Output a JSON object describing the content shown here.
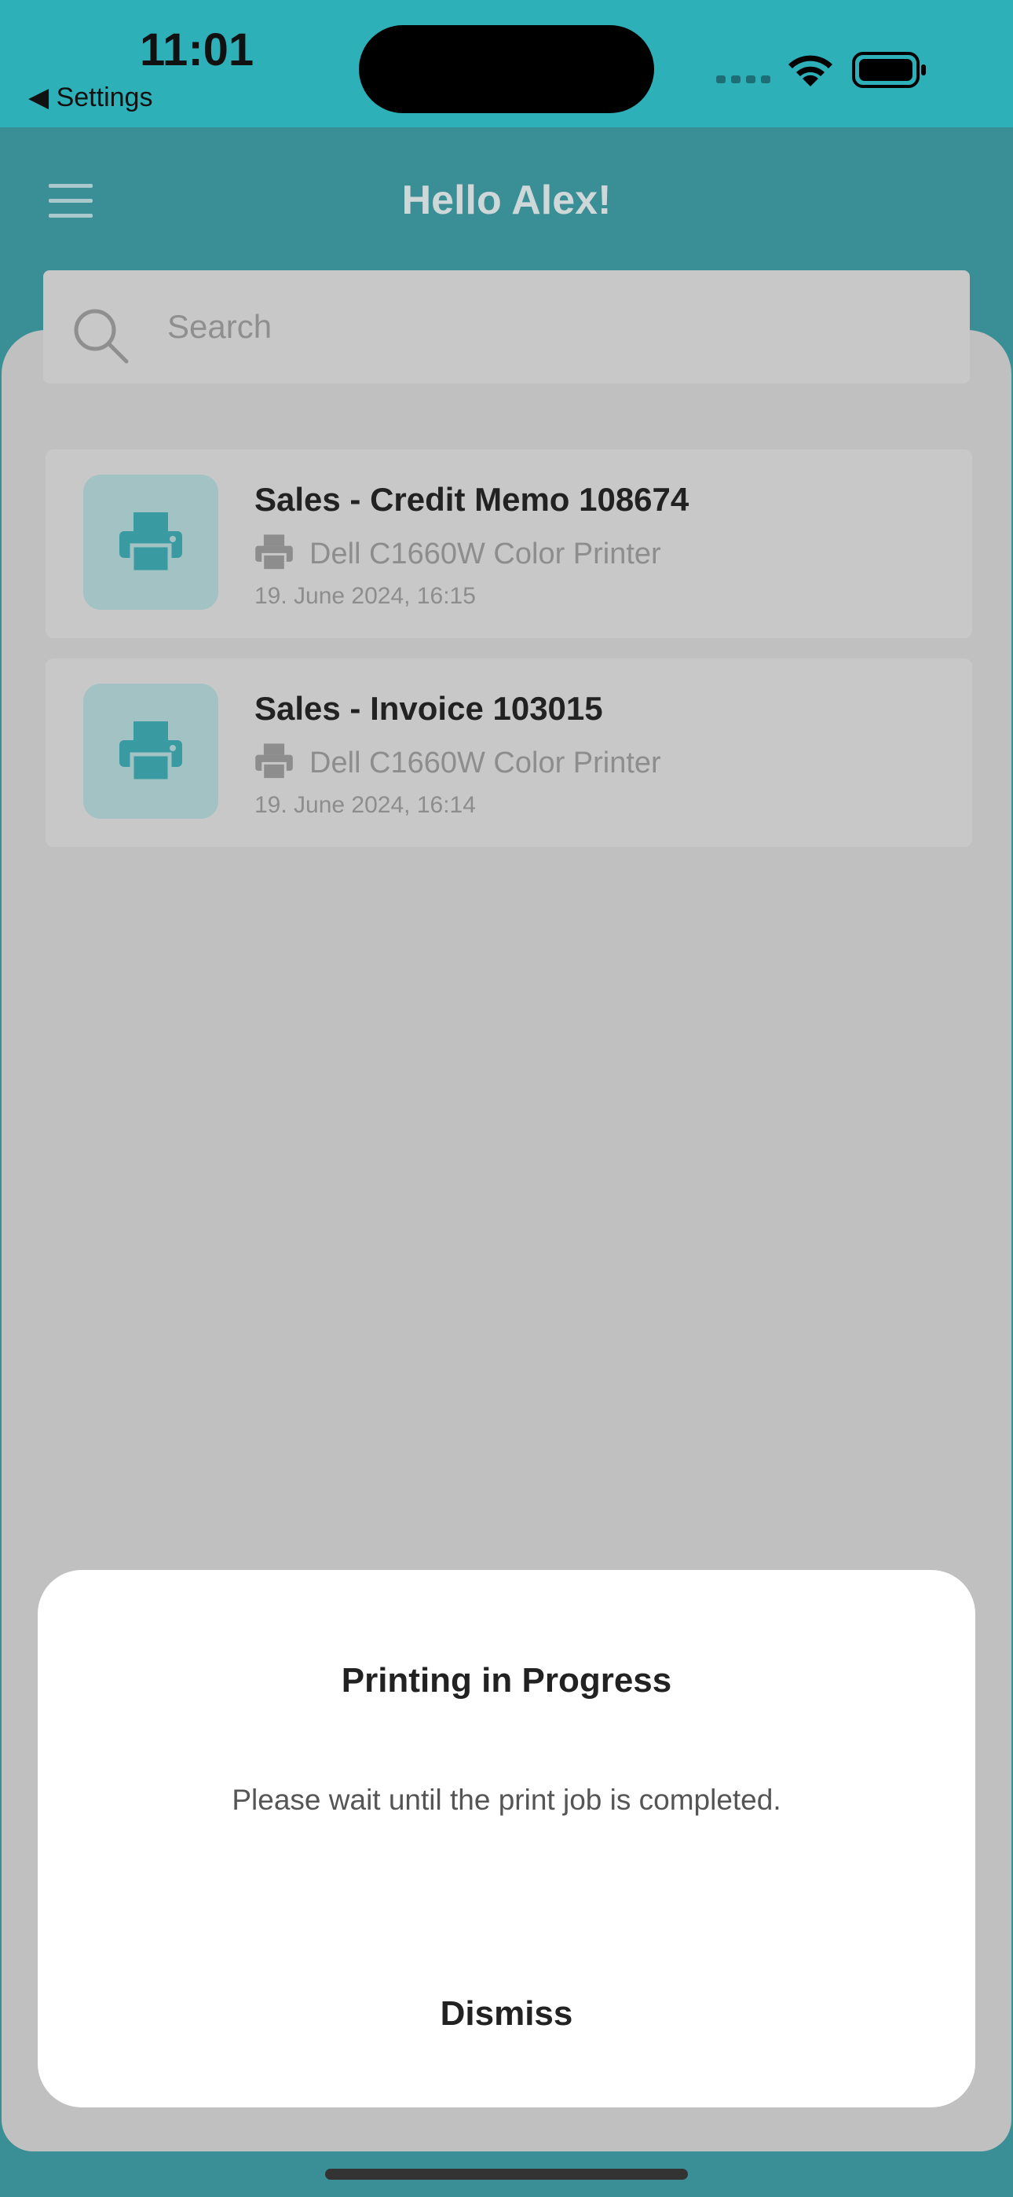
{
  "status_bar": {
    "time": "11:01",
    "back_label": "◀ Settings"
  },
  "header": {
    "title": "Hello Alex!"
  },
  "search": {
    "placeholder": "Search"
  },
  "jobs": [
    {
      "name": "Sales - Credit Memo 108674",
      "printer": "Dell C1660W Color Printer",
      "date": "19. June 2024, 16:15"
    },
    {
      "name": "Sales - Invoice 103015",
      "printer": "Dell C1660W Color Printer",
      "date": "19. June 2024, 16:14"
    }
  ],
  "dialog": {
    "title": "Printing in Progress",
    "message": "Please wait until the print job is completed.",
    "dismiss_label": "Dismiss"
  },
  "colors": {
    "accent": "#2eb0b9",
    "header": "#3a8e95"
  }
}
